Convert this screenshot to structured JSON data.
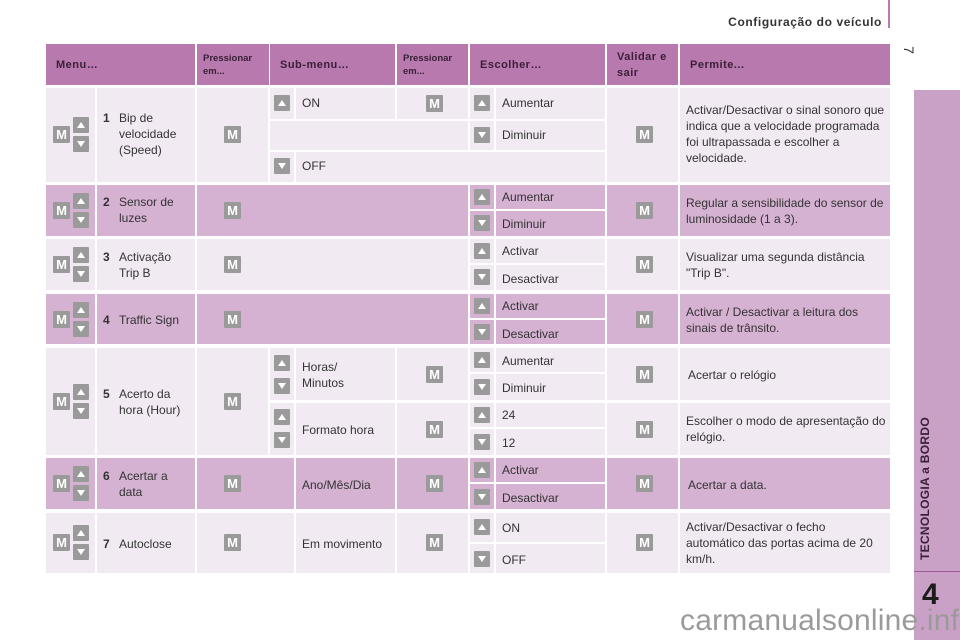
{
  "page": {
    "section_title": "Configuração do veículo",
    "page_number": "7",
    "chapter_title": "TECNOLOGIA a BORDO",
    "chapter_number": "4",
    "watermark": "carmanualsonline.info"
  },
  "colors": {
    "header_bg": "#b87aae",
    "row_light": "#f2eaf3",
    "row_dark": "#d6b2d2",
    "sidebar": "#c9a1c6",
    "icon_gray": "#9a9a9a"
  },
  "table": {
    "headers": {
      "menu": "Menu…",
      "press1": "Pressionar em...",
      "submenu": "Sub-menu…",
      "press2": "Pressionar em...",
      "choose": "Escolher…",
      "validate": "Validar e sair",
      "allows": "Permite..."
    },
    "icons": {
      "m_label": "M",
      "up": "up-arrow-icon",
      "down": "down-arrow-icon"
    },
    "rows": [
      {
        "num": "1",
        "menu": "Bip de velocidade (Speed)",
        "submenu_on": "ON",
        "submenu_off": "OFF",
        "choose_up": "Aumentar",
        "choose_down": "Diminuir",
        "allows": "Activar/Desactivar o sinal sonoro que indica que a velocidade programada foi ultrapassada e escolher a velocidade."
      },
      {
        "num": "2",
        "menu": "Sensor de luzes",
        "choose_up": "Aumentar",
        "choose_down": "Diminuir",
        "allows": "Regular a sensibilidade do sensor de luminosidade (1 a 3)."
      },
      {
        "num": "3",
        "menu": "Activação Trip B",
        "choose_up": "Activar",
        "choose_down": "Desactivar",
        "allows": "Visualizar uma segunda distância \"Trip B\"."
      },
      {
        "num": "4",
        "menu": "Traffic Sign",
        "choose_up": "Activar",
        "choose_down": "Desactivar",
        "allows": "Activar / Desactivar a leitura dos sinais de trânsito."
      },
      {
        "num": "5",
        "menu": "Acerto da hora (Hour)",
        "sub": [
          {
            "submenu": "Horas/ Minutos",
            "choose_up": "Aumentar",
            "choose_down": "Diminuir",
            "allows": "Acertar o relógio"
          },
          {
            "submenu": "Formato hora",
            "choose_up": "24",
            "choose_down": "12",
            "allows": "Escolher o modo de apresentação do relógio."
          }
        ]
      },
      {
        "num": "6",
        "menu": "Acertar a data",
        "submenu": "Ano/Mês/Dia",
        "choose_up": "Activar",
        "choose_down": "Desactivar",
        "allows": "Acertar a data."
      },
      {
        "num": "7",
        "menu": "Autoclose",
        "submenu": "Em movimento",
        "choose_up": "ON",
        "choose_down": "OFF",
        "allows": "Activar/Desactivar o fecho automático das portas acima de 20 km/h."
      }
    ]
  }
}
